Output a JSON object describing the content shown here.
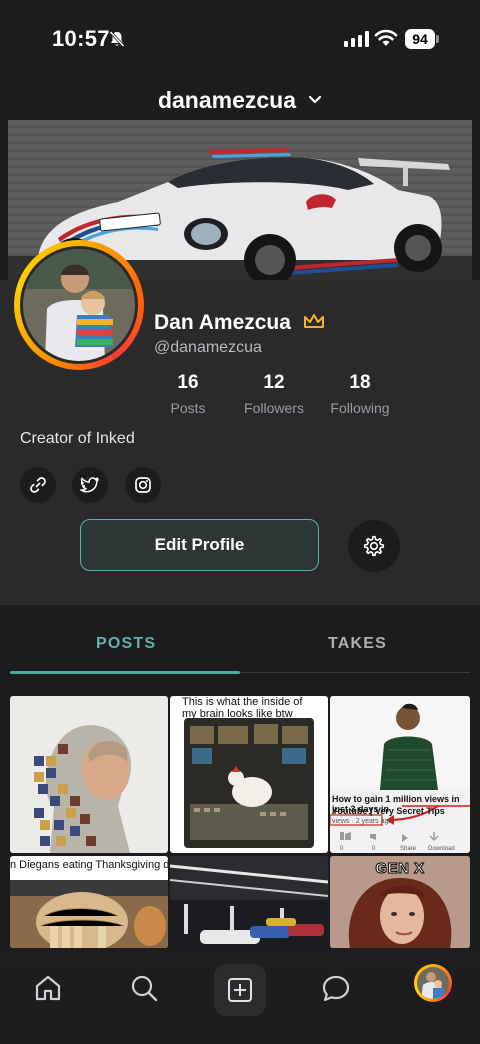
{
  "status_bar": {
    "time": "10:57",
    "battery": "94"
  },
  "header": {
    "username": "danamezcua"
  },
  "profile": {
    "display_name": "Dan Amezcua",
    "handle": "@danamezcua",
    "bio": "Creator of Inked",
    "stats": [
      {
        "value": "16",
        "label": "Posts"
      },
      {
        "value": "12",
        "label": "Followers"
      },
      {
        "value": "18",
        "label": "Following"
      }
    ],
    "social": [
      "link-icon",
      "twitter-icon",
      "instagram-icon"
    ],
    "edit_label": "Edit Profile"
  },
  "tabs": [
    {
      "label": "POSTS",
      "active": true
    },
    {
      "label": "TAKES",
      "active": false
    }
  ],
  "posts": {
    "meme_brain_caption": "This is what the inside of my brain looks like btw",
    "youtube_title_1": "How to gain 1 million views in just 3 days in",
    "youtube_title_2": "Youtube | Very Secret Tips",
    "youtube_meta": "views · 2 years ago",
    "youtube_share": "Share",
    "youtube_download": "Download",
    "youtube_like_count": "0",
    "youtube_dislike_count": "0",
    "thanksgiving_caption": "n Diegans eating Thanksgiving dinner",
    "genx_label": "GEN X"
  },
  "nav": {
    "items": [
      "home-icon",
      "search-icon",
      "create-icon",
      "chat-icon",
      "profile-avatar"
    ]
  },
  "colors": {
    "accent": "#4fb8ad",
    "crown": "#f0b429",
    "background": "#1c1c1e",
    "card": "#2a2a2c"
  }
}
